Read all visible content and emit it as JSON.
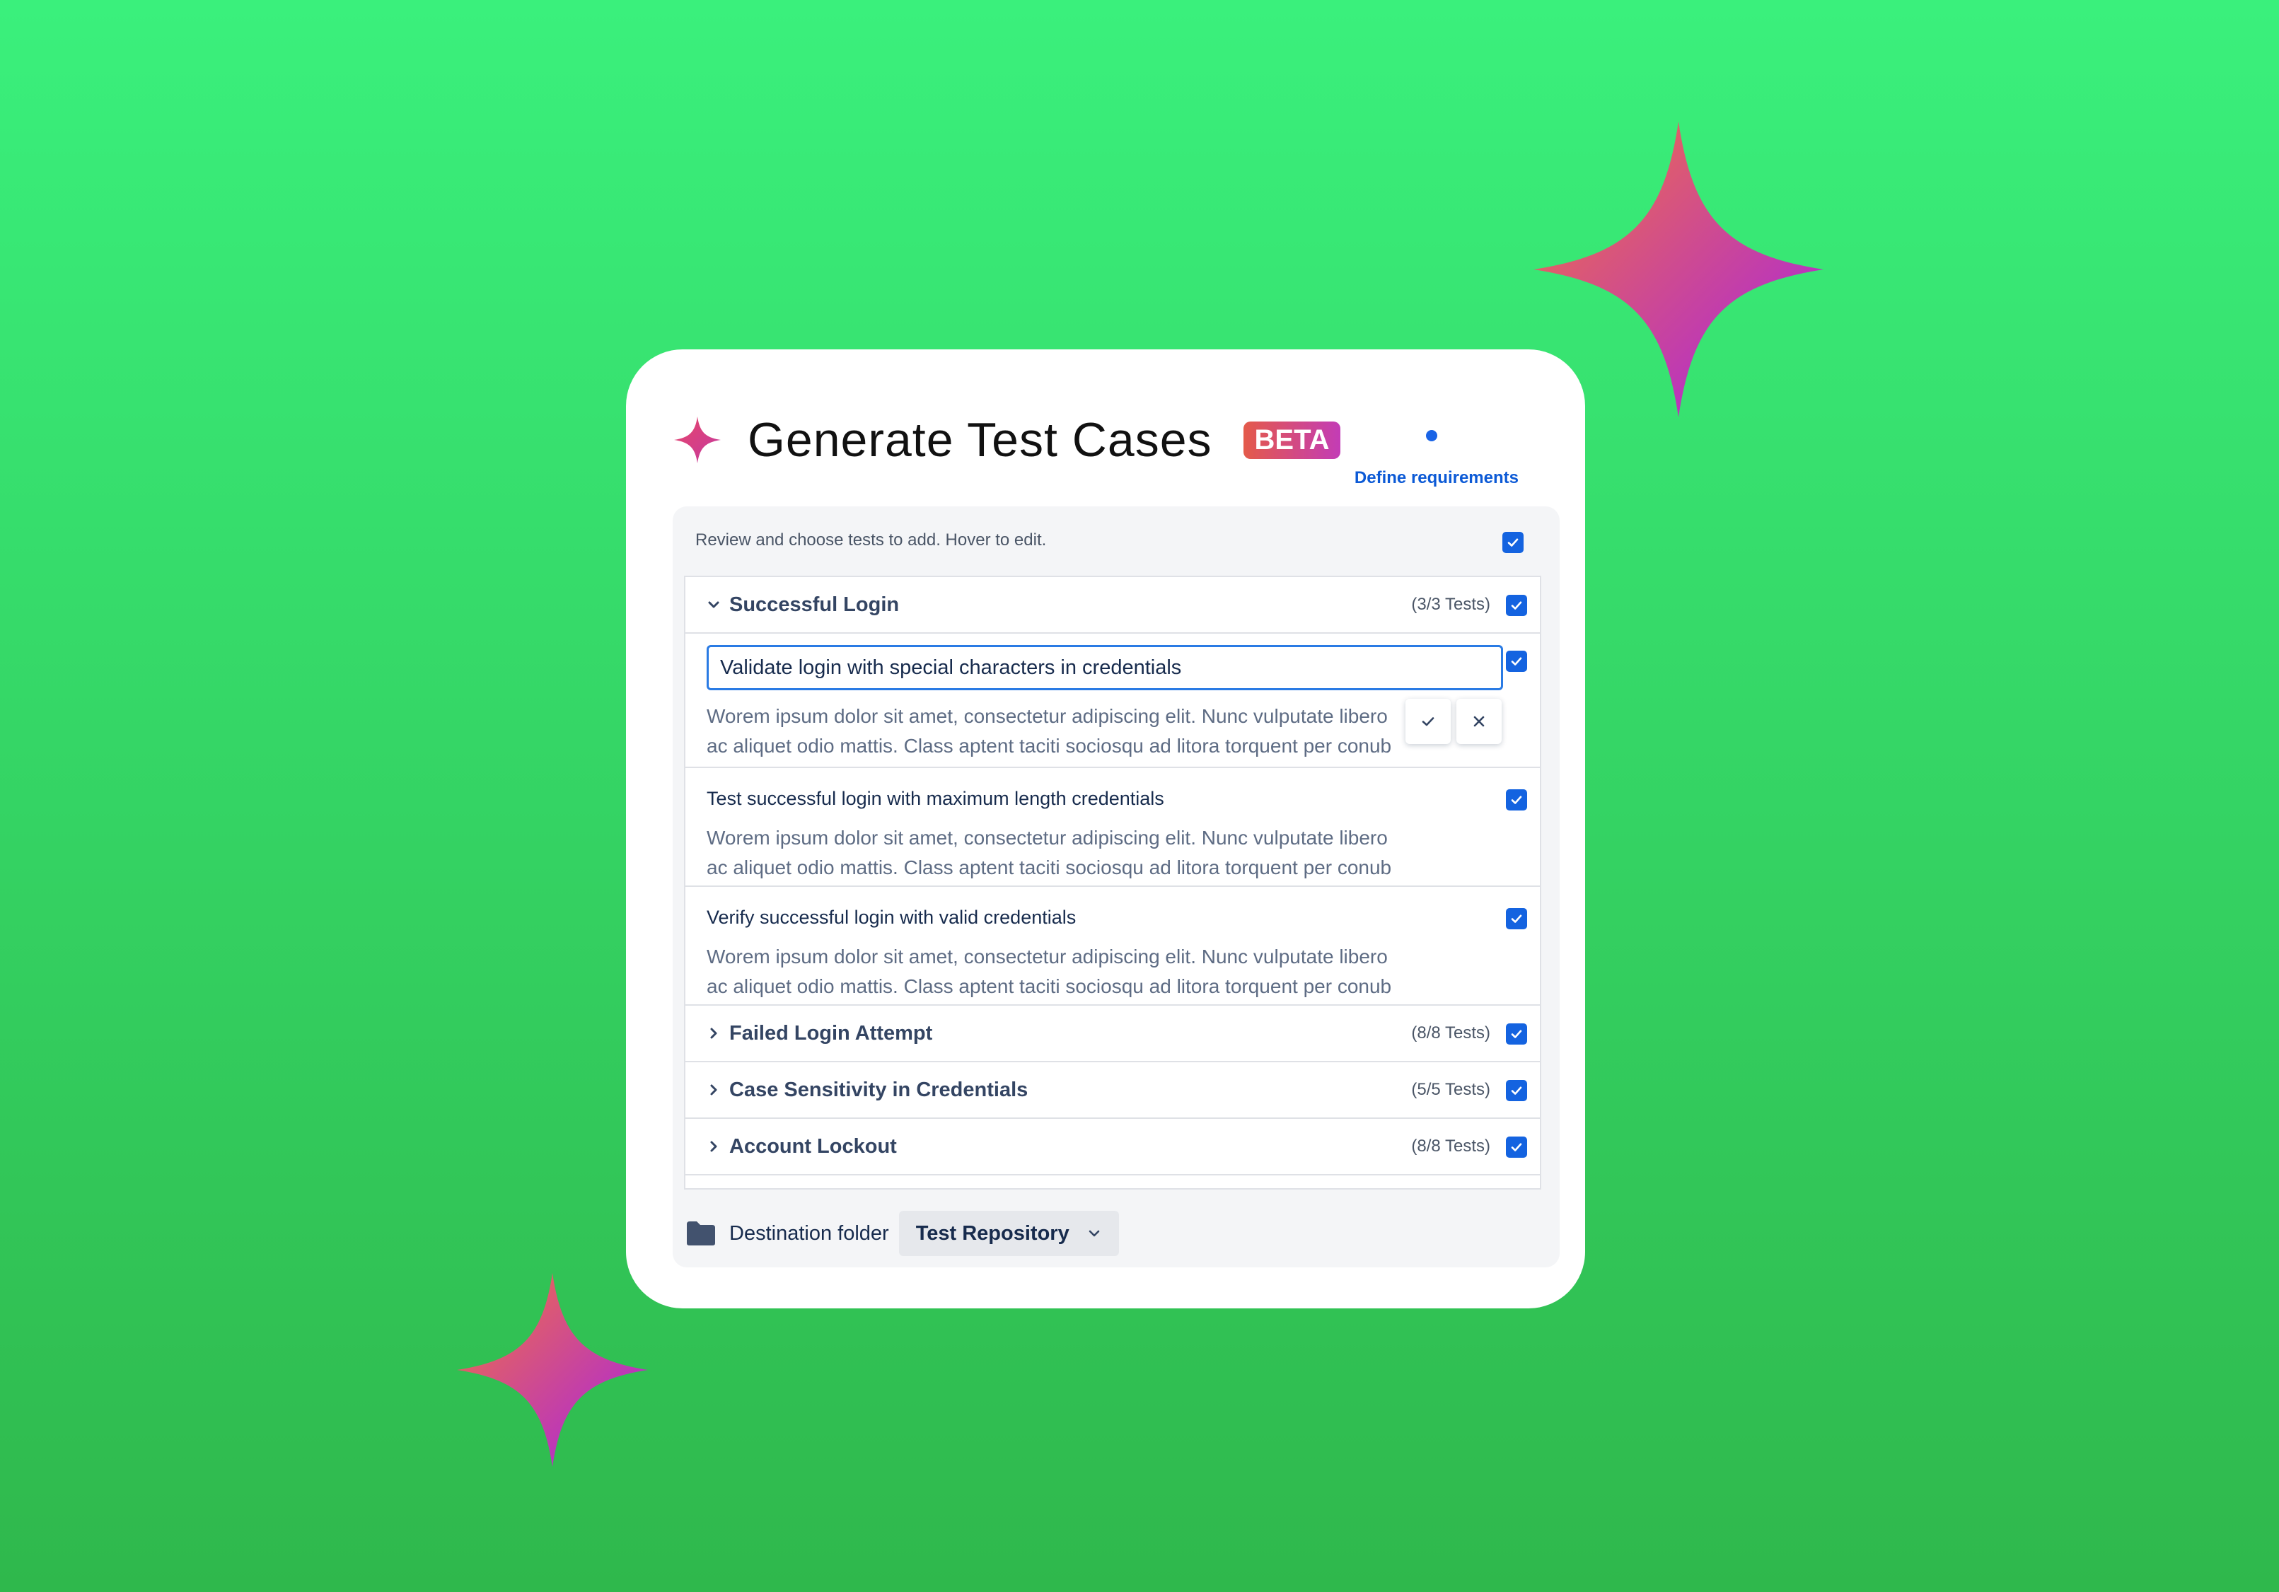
{
  "colors": {
    "accent": "#1463e0",
    "background_top": "#3af07c",
    "background_bottom": "#2fb84c",
    "sparkle_gradient_start": "#f4743e",
    "sparkle_gradient_end": "#a61fe8"
  },
  "icons": {
    "logo": "sparkle-icon",
    "checkbox": "checkmark-icon",
    "expanded": "chevron-down-icon",
    "collapsed": "chevron-right-icon",
    "confirm": "check-icon",
    "cancel": "close-icon",
    "folder": "folder-icon"
  },
  "header": {
    "title": "Generate Test Cases",
    "badge": "BETA",
    "define_link": "Define requirements"
  },
  "panel": {
    "hint": "Review and choose tests to add. Hover to edit.",
    "select_all_checked": true,
    "groups": [
      {
        "name": "Successful Login",
        "count": "(3/3 Tests)",
        "expanded": true,
        "checked": true,
        "tests": [
          {
            "title": "Validate login with special characters in credentials",
            "editing": true,
            "checked": true,
            "desc_line1": "Worem ipsum dolor sit amet, consectetur adipiscing elit. Nunc vulputate libero",
            "desc_line2": "ac aliquet odio mattis. Class aptent taciti sociosqu ad litora torquent per conub"
          },
          {
            "title": "Test successful login with maximum length credentials",
            "editing": false,
            "checked": true,
            "desc_line1": "Worem ipsum dolor sit amet, consectetur adipiscing elit. Nunc vulputate libero",
            "desc_line2": "ac aliquet odio mattis. Class aptent taciti sociosqu ad litora torquent per conub"
          },
          {
            "title": "Verify successful login with valid credentials",
            "editing": false,
            "checked": true,
            "desc_line1": "Worem ipsum dolor sit amet, consectetur adipiscing elit. Nunc vulputate libero",
            "desc_line2": "ac aliquet odio mattis. Class aptent taciti sociosqu ad litora torquent per conub"
          }
        ]
      },
      {
        "name": "Failed Login Attempt",
        "count": "(8/8 Tests)",
        "expanded": false,
        "checked": true
      },
      {
        "name": "Case Sensitivity in Credentials",
        "count": "(5/5 Tests)",
        "expanded": false,
        "checked": true
      },
      {
        "name": "Account Lockout",
        "count": "(8/8 Tests)",
        "expanded": false,
        "checked": true
      }
    ]
  },
  "footer": {
    "destination_label": "Destination folder",
    "destination_value": "Test Repository"
  }
}
